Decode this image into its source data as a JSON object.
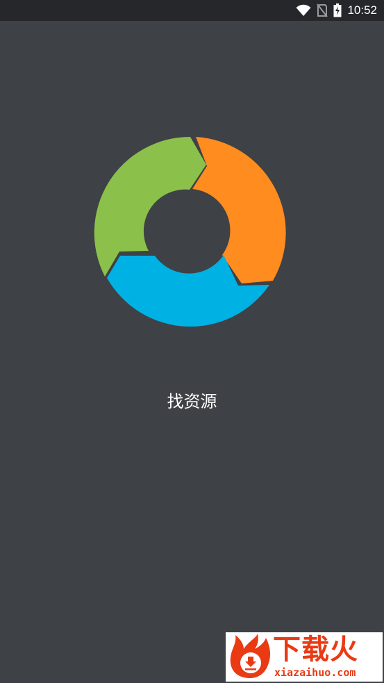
{
  "status_bar": {
    "time": "10:52",
    "icons": [
      "wifi-icon",
      "no-sim-icon",
      "battery-charging-icon"
    ]
  },
  "splash": {
    "app_name": "找资源",
    "logo_colors": {
      "green": "#8bc14b",
      "orange": "#ff8c1f",
      "blue": "#00b1e4"
    },
    "background": "#3e4146"
  },
  "watermark": {
    "brand": "下载火",
    "url": "xiazaihuo.com",
    "color": "#ea3a14"
  }
}
